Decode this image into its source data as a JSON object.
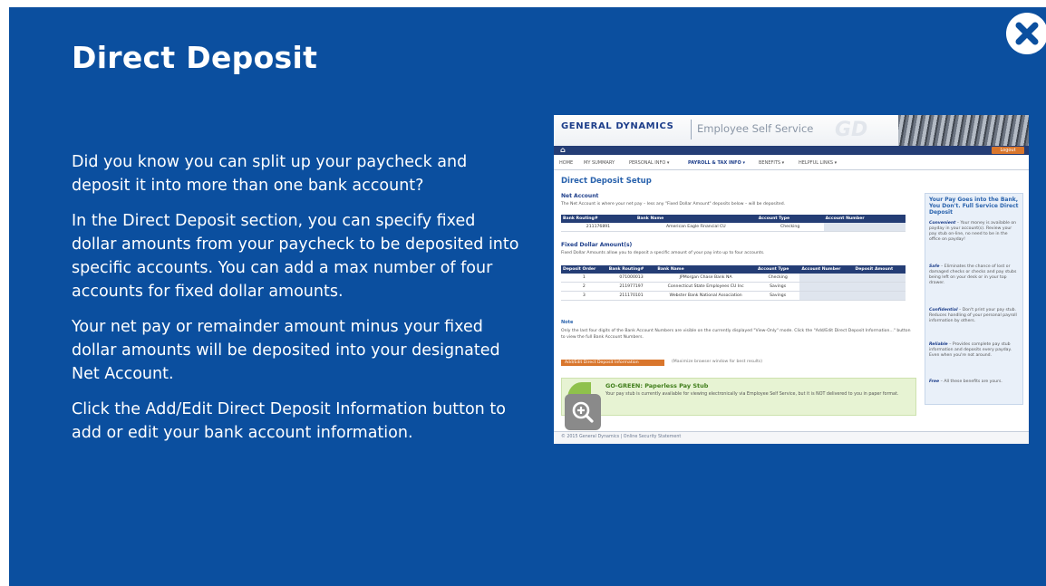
{
  "slide": {
    "title": "Direct Deposit",
    "paragraphs": [
      "Did you know you can split up your paycheck and deposit it into more than one bank account?",
      "In the Direct Deposit section, you can specify fixed dollar amounts from your paycheck to be deposited into specific accounts. You can add a max number of four accounts for fixed dollar amounts.",
      "Your net pay or remainder amount minus your fixed dollar amounts will be deposited into your designated Net Account.",
      "Click the Add/Edit Direct Deposit Information button to add or edit your bank account information."
    ],
    "close_icon": "close-icon",
    "colors": {
      "background": "#0b4f9f",
      "text": "#ffffff"
    }
  },
  "screenshot": {
    "brand": "GENERAL DYNAMICS",
    "app_name": "Employee Self Service",
    "logo": "GD",
    "logout_label": "Logout",
    "menu": [
      "HOME",
      "MY SUMMARY",
      "PERSONAL INFO ▾",
      "PAYROLL & TAX INFO ▾",
      "BENEFITS ▾",
      "HELPFUL LINKS ▾"
    ],
    "active_menu_index": 3,
    "page_title": "Direct Deposit Setup",
    "net_account": {
      "heading": "Net Account",
      "description": "The Net Account is where your net pay – less any \"Fixed Dollar Amount\" deposits below – will be deposited.",
      "columns": [
        "Bank Routing#",
        "Bank Name",
        "Account Type",
        "Account Number"
      ],
      "rows": [
        [
          "211176891",
          "American Eagle Financial CU",
          "Checking",
          ""
        ]
      ]
    },
    "fixed_amounts": {
      "heading": "Fixed Dollar Amount(s)",
      "description": "Fixed Dollar Amounts allow you to deposit a specific amount of your pay into up to four accounts.",
      "columns": [
        "Deposit Order",
        "Bank Routing#",
        "Bank Name",
        "Account Type",
        "Account Number",
        "Deposit Amount"
      ],
      "rows": [
        [
          "1",
          "071000013",
          "JPMorgan Chase Bank NA",
          "Checking",
          "",
          ""
        ],
        [
          "2",
          "211977197",
          "Connecticut State Employees CU Inc",
          "Savings",
          "",
          ""
        ],
        [
          "3",
          "211170101",
          "Webster Bank National Association",
          "Savings",
          "",
          ""
        ]
      ]
    },
    "note_heading": "Note",
    "note_text": "Only the last four digits of the Bank Account Numbers are visible on the currently displayed \"View-Only\" mode. Click the \"Add/Edit Direct Deposit Information...\" button to view the full Bank Account Numbers.",
    "add_edit_button": "Add/Edit Direct Deposit Information",
    "maximize_note": "(Maximize browser window for best results)",
    "gogreen": {
      "title": "GO-GREEN: Paperless Pay Stub",
      "text": "Your pay stub is currently available for viewing electronically via Employee Self Service, but it is NOT delivered to you in paper format."
    },
    "sidebar": {
      "title": "Your Pay Goes into the Bank, You Don't. Full Service Direct Deposit",
      "items": [
        {
          "term": "Convenient",
          "text": " – Your money is available on payday in your account(s). Review your pay stub on-line, no need to be in the office on payday!"
        },
        {
          "term": "Safe",
          "text": " – Eliminates the chance of lost or damaged checks or checks and pay stubs being left on your desk or in your top drawer."
        },
        {
          "term": "Confidential",
          "text": " – Don't print your pay stub. Reduces handling of your personal payroll information by others."
        },
        {
          "term": "Reliable",
          "text": " – Provides complete pay stub information and deposits every payday. Even when you're not around."
        },
        {
          "term": "Free",
          "text": " – All these benefits are yours."
        }
      ]
    },
    "footer": "© 2015 General Dynamics  |  Online Security Statement",
    "zoom_icon": "zoom-in-icon"
  }
}
